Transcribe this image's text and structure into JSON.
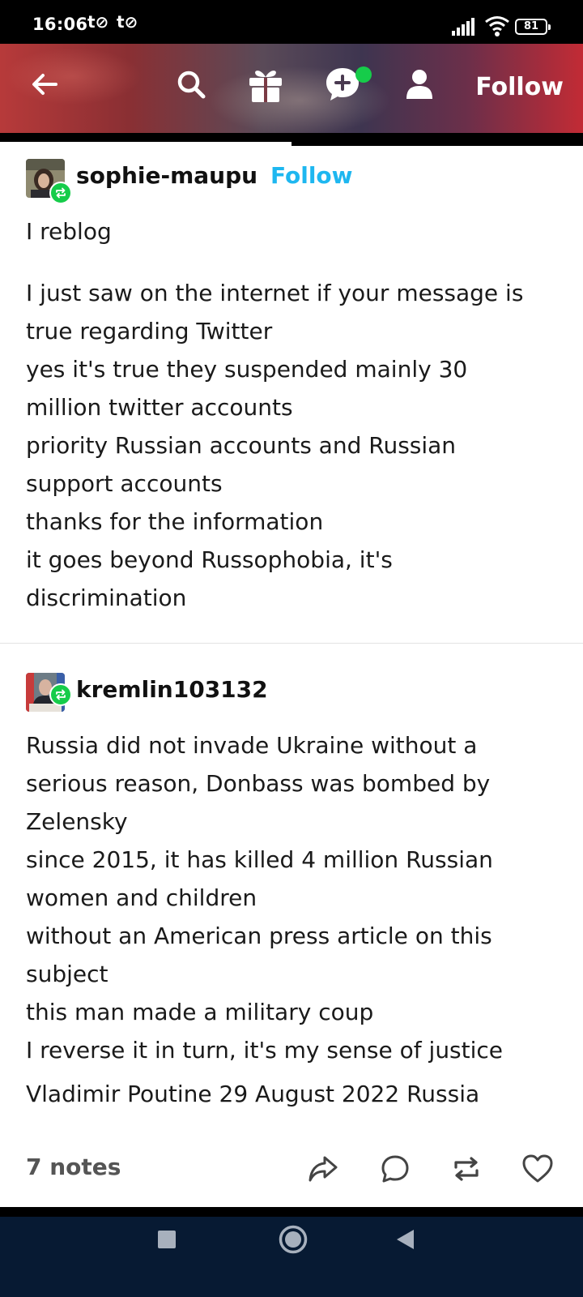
{
  "status_bar": {
    "time": "16:06",
    "notif_icons": [
      "t⊘",
      "t⊘"
    ],
    "battery": "81"
  },
  "header": {
    "follow_label": "Follow",
    "icons": [
      "back-arrow-icon",
      "search-icon",
      "gift-icon",
      "new-chat-icon",
      "profile-icon"
    ]
  },
  "posts": [
    {
      "username": "sophie-maupu",
      "follow_label": "Follow",
      "intro": "I reblog",
      "body": "I just saw on the internet if your message is\ntrue regarding Twitter\nyes it's true they suspended mainly 30\nmillion twitter accounts\npriority Russian accounts and Russian\nsupport accounts\nthanks for the information\nit goes beyond Russophobia, it's\ndiscrimination"
    },
    {
      "username": "kremlin103132",
      "body": "Russia did not invade Ukraine without a\nserious reason, Donbass was bombed by\nZelensky\nsince 2015, it has killed 4 million Russian\nwomen and children\nwithout an American press article on this\nsubject\nthis man made a military coup\nI reverse it in turn, it's my sense of justice",
      "signature": "Vladimir Poutine 29 August 2022 Russia"
    }
  ],
  "footer": {
    "notes": "7 notes",
    "actions": [
      "share-icon",
      "reply-icon",
      "reblog-icon",
      "like-icon"
    ]
  },
  "colors": {
    "follow_blue": "#1eb7f0",
    "reblog_green": "#16cc4a",
    "nav_bg": "#071a33"
  }
}
